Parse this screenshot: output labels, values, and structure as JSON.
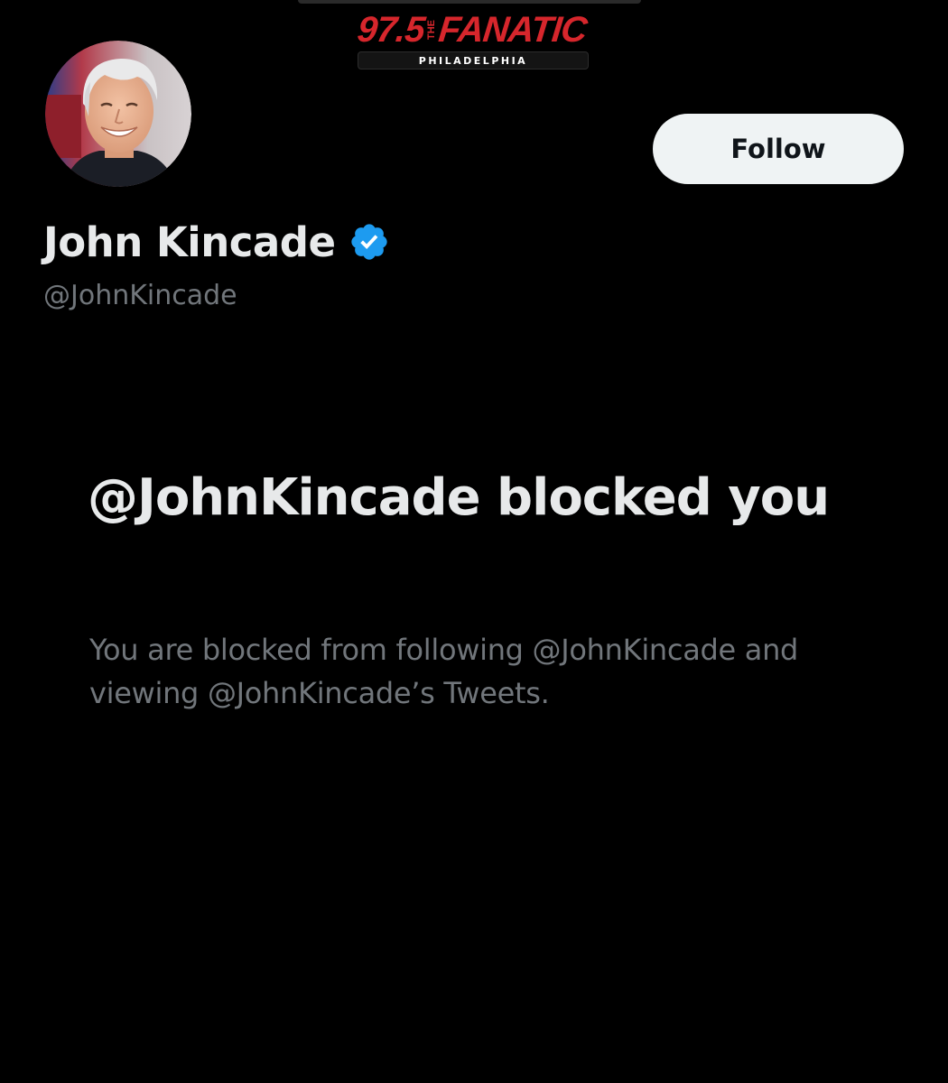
{
  "station_logo": {
    "frequency": "97.5",
    "the": "THE",
    "name": "FANATIC",
    "city": "PHILADELPHIA",
    "color": "#d6262c"
  },
  "profile": {
    "display_name": "John Kincade",
    "handle": "@JohnKincade",
    "verified": true,
    "verified_icon": "verified-badge-icon",
    "badge_color": "#1d9bf0"
  },
  "actions": {
    "follow_label": "Follow"
  },
  "blocked_notice": {
    "title": "@JohnKincade blocked you",
    "description": "You are blocked from following @JohnKincade and viewing @JohnKincade’s Tweets."
  },
  "theme": {
    "background": "#000000",
    "primary_text": "#e7e9ea",
    "secondary_text": "#71767b",
    "button_bg": "#eff3f4"
  }
}
